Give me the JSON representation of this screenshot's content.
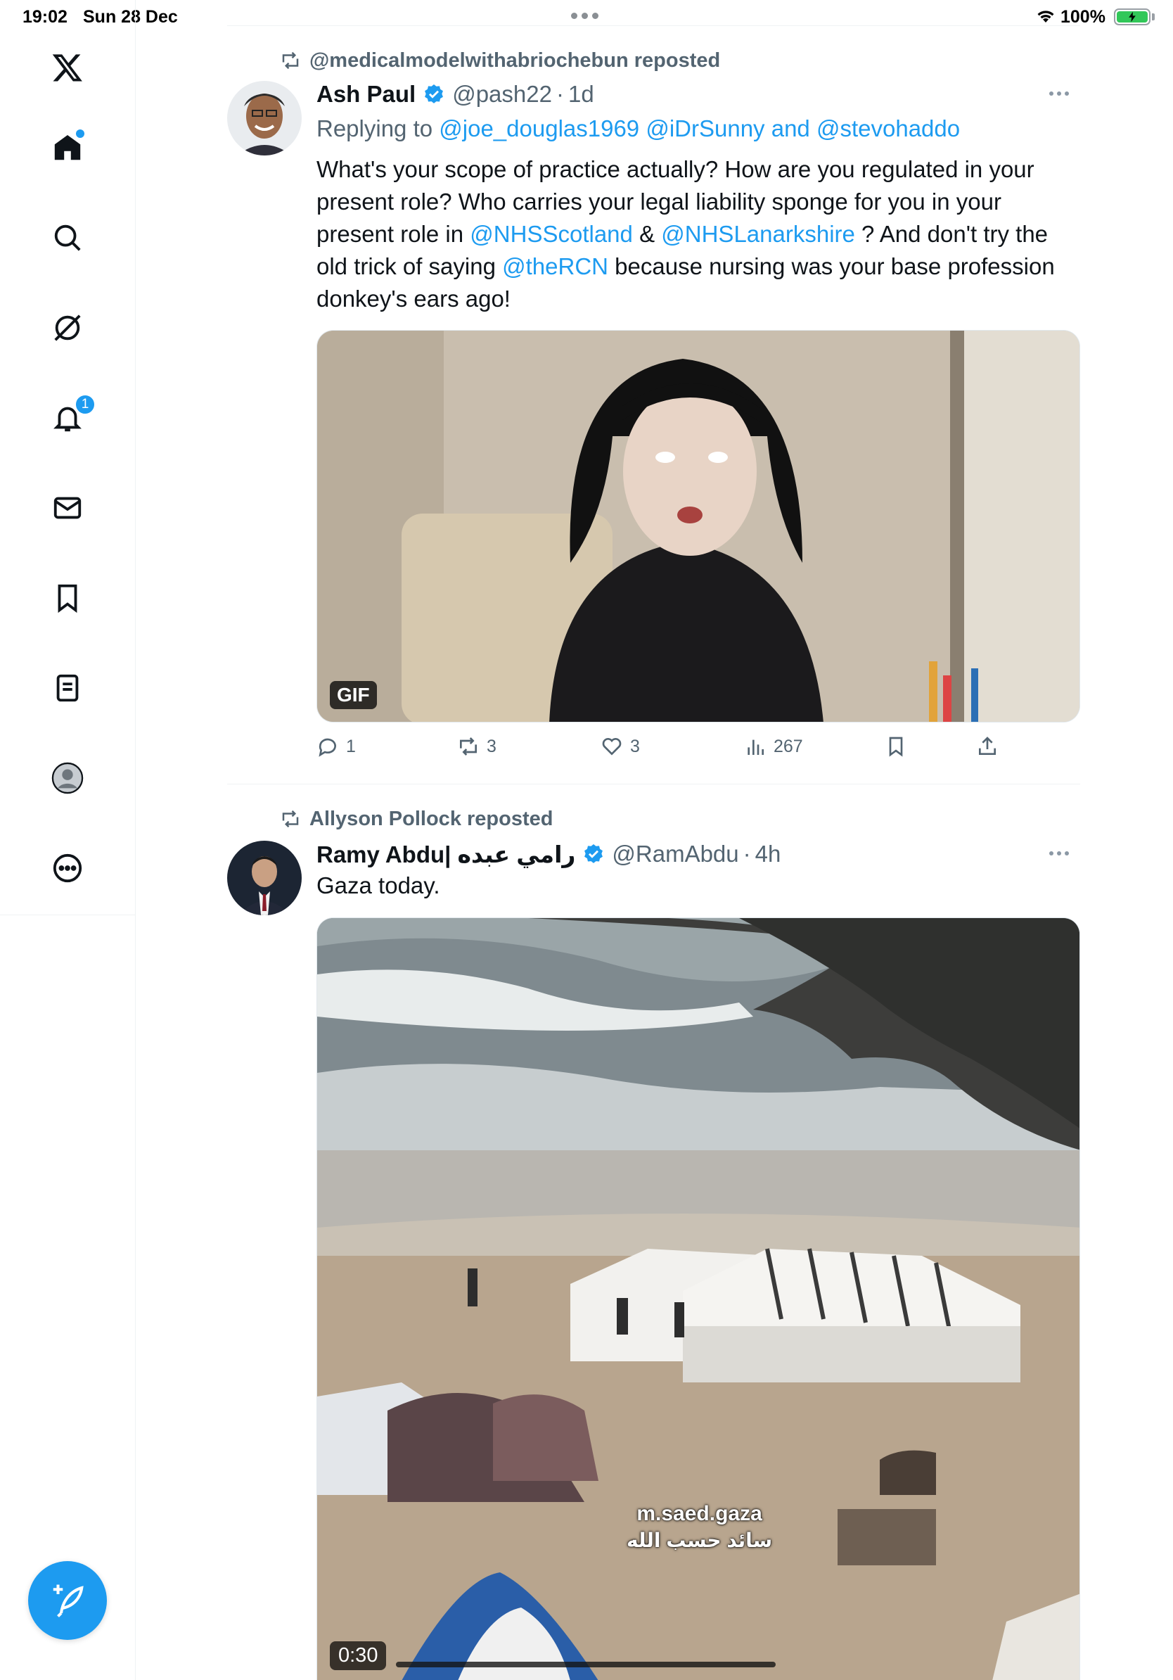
{
  "status_bar": {
    "time": "19:02",
    "date": "Sun 28 Dec",
    "battery": "100%"
  },
  "sidebar": {
    "notifications_badge": "1",
    "items": [
      "x-logo",
      "home",
      "search",
      "grok",
      "notifications",
      "messages",
      "bookmarks",
      "lists",
      "profile",
      "more"
    ]
  },
  "tweets": [
    {
      "repost_label": "@medicalmodelwithabriochebun reposted",
      "name": "Ash Paul",
      "handle": "@pash22",
      "sep": "·",
      "time": "1d",
      "reply_prefix": "Replying to ",
      "reply_to": "@joe_douglas1969 @iDrSunny",
      "reply_and": " and ",
      "reply_last": "@stevohaddo",
      "text_1": "What's your scope of practice actually? How are you regulated in your present role? Who carries your legal liability sponge for you in your present role in ",
      "mention_1": "@NHSScotland",
      "text_2": " & ",
      "mention_2": "@NHSLanarkshire",
      "text_3": " ? And don't try the old trick of saying ",
      "mention_3": "@theRCN",
      "text_4": " because nursing was your base profession donkey's ears ago!",
      "media_badge": "GIF",
      "replies": "1",
      "reposts": "3",
      "likes": "3",
      "views": "267"
    },
    {
      "repost_label": "Allyson Pollock reposted",
      "name": "Ramy Abdu| رامي عبده",
      "handle": "@RamAbdu",
      "sep": "·",
      "time": "4h",
      "text": "Gaza today.",
      "video_time": "0:30",
      "watermark_1": "m.saed.gaza",
      "watermark_2": "سائد حسب الله"
    }
  ],
  "colors": {
    "accent": "#1d9bf0",
    "text": "#0f1419",
    "secondary": "#536471"
  }
}
